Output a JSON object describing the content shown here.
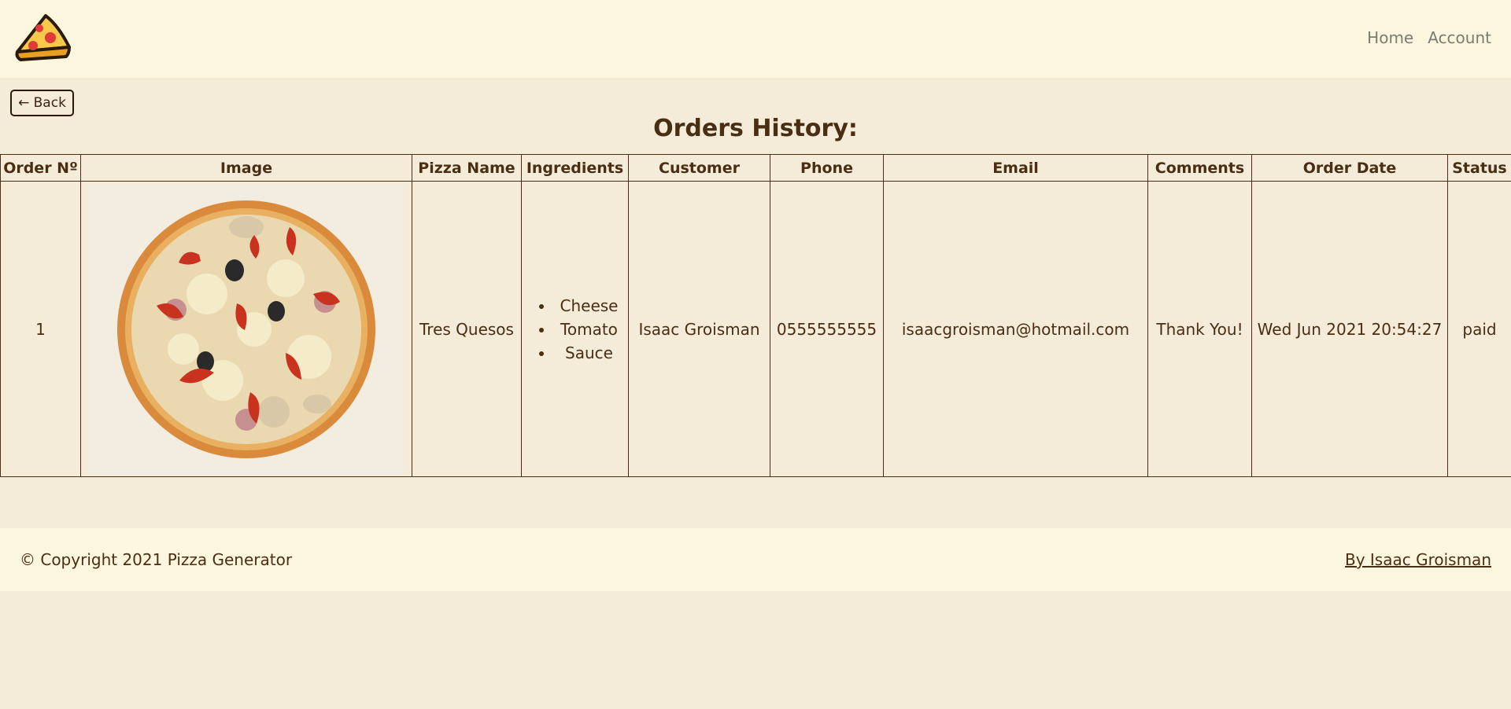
{
  "nav": {
    "links": [
      "Home",
      "Account"
    ]
  },
  "back_button": "← Back",
  "page_title": "Orders History:",
  "table": {
    "headers": [
      "Order Nº",
      "Image",
      "Pizza Name",
      "Ingredients",
      "Customer",
      "Phone",
      "Email",
      "Comments",
      "Order Date",
      "Status"
    ],
    "rows": [
      {
        "order_no": "1",
        "image": "pizza-photo",
        "pizza_name": "Tres Quesos",
        "ingredients": [
          "Cheese",
          "Tomato",
          "Sauce"
        ],
        "customer": "Isaac Groisman",
        "phone": "0555555555",
        "email": "isaacgroisman@hotmail.com",
        "comments": "Thank You!",
        "order_date": "Wed Jun 2021 20:54:27",
        "status": "paid"
      }
    ]
  },
  "footer": {
    "copyright": "© Copyright 2021 Pizza Generator",
    "author_link": "By Isaac Groisman"
  },
  "colors": {
    "page_bg": "#f4ecd8",
    "bar_bg": "#fdf6df",
    "text_brown": "#4a2e14",
    "nav_gray": "#7b7b72"
  }
}
